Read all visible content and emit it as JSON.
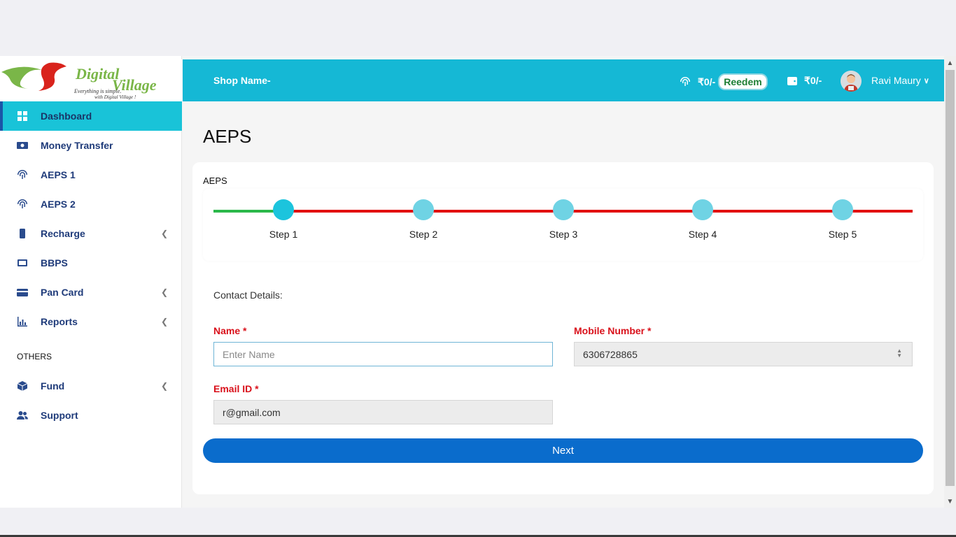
{
  "header": {
    "shop_name": "Shop Name-",
    "wallet_amount": "₹0/-",
    "redeem_label": "Reedem",
    "balance_amount": "₹0/-",
    "user_name": "Ravi Maury",
    "bg_color": "#15b8d5"
  },
  "sidebar": {
    "items": [
      {
        "label": "Dashboard",
        "icon": "dashboard-icon"
      },
      {
        "label": "Money Transfer",
        "icon": "money-icon"
      },
      {
        "label": "AEPS 1",
        "icon": "fingerprint-icon"
      },
      {
        "label": "AEPS 2",
        "icon": "fingerprint-icon"
      },
      {
        "label": "Recharge",
        "icon": "mobile-icon"
      },
      {
        "label": "BBPS",
        "icon": "bill-icon"
      },
      {
        "label": "Pan Card",
        "icon": "card-icon"
      },
      {
        "label": "Reports",
        "icon": "chart-icon"
      }
    ],
    "section_label": "OTHERS",
    "other_items": [
      {
        "label": "Fund",
        "icon": "box-icon"
      },
      {
        "label": "Support",
        "icon": "users-icon"
      }
    ],
    "active_color": "#19c3d8"
  },
  "page": {
    "title": "AEPS",
    "card_label": "AEPS"
  },
  "stepper": {
    "steps": [
      "Step 1",
      "Step 2",
      "Step 3",
      "Step 4",
      "Step 5"
    ],
    "active_step": 1
  },
  "form": {
    "title": "Contact Details:",
    "name_label": "Name *",
    "name_placeholder": "Enter Name",
    "mobile_label": "Mobile Number *",
    "mobile_value": "6306728865",
    "email_label": "Email ID *",
    "email_value": "r@gmail.com",
    "next_label": "Next"
  }
}
